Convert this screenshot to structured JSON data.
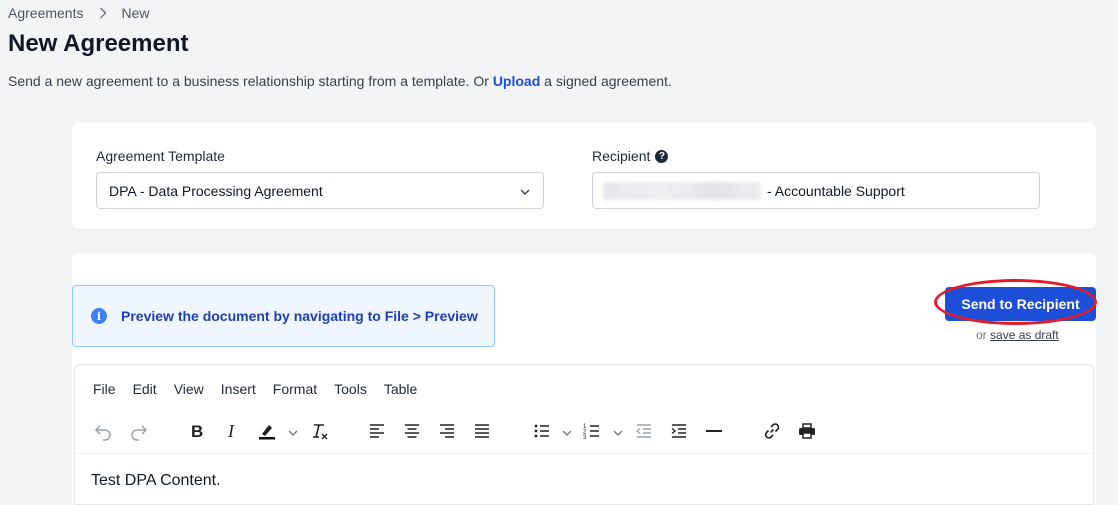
{
  "breadcrumb": {
    "parent": "Agreements",
    "current": "New"
  },
  "page": {
    "title": "New Agreement",
    "subtitle_before": "Send a new agreement to a business relationship starting from a template. Or ",
    "subtitle_link": "Upload",
    "subtitle_after": " a signed agreement."
  },
  "form": {
    "template_label": "Agreement Template",
    "template_value": "DPA - Data Processing Agreement",
    "recipient_label": "Recipient",
    "recipient_help": "?",
    "recipient_value": "- Accountable Support"
  },
  "alert": {
    "text": "Preview the document by navigating to File > Preview",
    "icon": "i"
  },
  "actions": {
    "send_label": "Send to Recipient",
    "or_text": "or ",
    "draft_label": "save as draft"
  },
  "editor": {
    "menu": [
      "File",
      "Edit",
      "View",
      "Insert",
      "Format",
      "Tools",
      "Table"
    ],
    "toolbar_icons": [
      "undo-icon",
      "redo-icon",
      "bold-icon",
      "italic-icon",
      "highlight-icon",
      "clear-format-icon",
      "align-left-icon",
      "align-center-icon",
      "align-right-icon",
      "justify-icon",
      "bullet-list-icon",
      "numbered-list-icon",
      "outdent-icon",
      "indent-icon",
      "horizontal-rule-icon",
      "link-icon",
      "print-icon"
    ],
    "content": "Test DPA Content."
  },
  "colors": {
    "primary": "#1d4ed8",
    "annotation": "#e11d2a",
    "alert_bg": "#eff6ff"
  }
}
